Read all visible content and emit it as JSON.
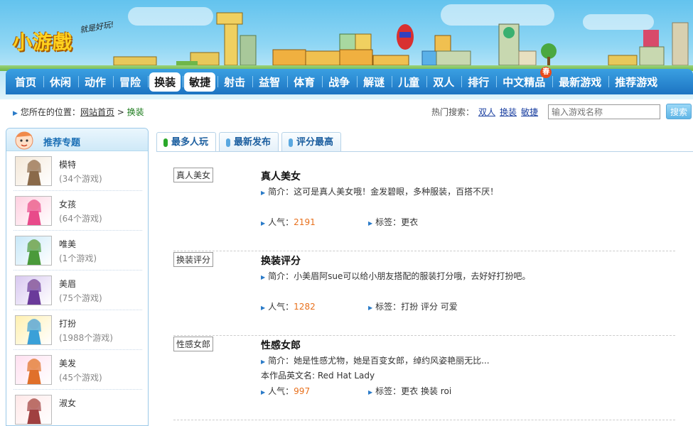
{
  "brand": {
    "logo": "小游戲",
    "slogan": "就是好玩!"
  },
  "nav": {
    "items": [
      {
        "label": "首页",
        "active": false
      },
      {
        "label": "休闲",
        "active": false
      },
      {
        "label": "动作",
        "active": false
      },
      {
        "label": "冒险",
        "active": false
      },
      {
        "label": "换装",
        "active": true
      },
      {
        "label": "敏捷",
        "active": true
      },
      {
        "label": "射击",
        "active": false
      },
      {
        "label": "益智",
        "active": false
      },
      {
        "label": "体育",
        "active": false
      },
      {
        "label": "战争",
        "active": false
      },
      {
        "label": "解谜",
        "active": false
      },
      {
        "label": "儿童",
        "active": false
      },
      {
        "label": "双人",
        "active": false
      },
      {
        "label": "排行",
        "active": false
      },
      {
        "label": "中文精品",
        "active": false,
        "badge": "春"
      },
      {
        "label": "最新游戏",
        "active": false
      },
      {
        "label": "推荐游戏",
        "active": false
      }
    ]
  },
  "location": {
    "prefix": "您所在的位置：",
    "home": "网站首页",
    "sep": " > ",
    "current": "换装"
  },
  "hot_search": {
    "label": "热门搜索：",
    "links": [
      "双人",
      "换装",
      "敏捷"
    ]
  },
  "search": {
    "placeholder": "输入游戏名称",
    "button": "搜索"
  },
  "sidebar": {
    "title": "推荐专题",
    "categories": [
      {
        "name": "模特",
        "count": "(34个游戏)"
      },
      {
        "name": "女孩",
        "count": "(64个游戏)"
      },
      {
        "name": "唯美",
        "count": "(1个游戏)"
      },
      {
        "name": "美眉",
        "count": "(75个游戏)"
      },
      {
        "name": "打扮",
        "count": "(1988个游戏)"
      },
      {
        "name": "美发",
        "count": "(45个游戏)"
      },
      {
        "name": "淑女",
        "count": ""
      }
    ]
  },
  "tabs": [
    {
      "label": "最多人玩",
      "active": true
    },
    {
      "label": "最新发布",
      "active": false
    },
    {
      "label": "评分最高",
      "active": false
    }
  ],
  "games": [
    {
      "tag": "真人美女",
      "title": "真人美女",
      "desc": "简介：这可是真人美女哦！金发碧眼，多种服装，百搭不厌！",
      "extra": "",
      "pop_label": "人气：",
      "pop": "2191",
      "tags_label": "标签：",
      "tags": "更衣"
    },
    {
      "tag": "换装评分",
      "title": "换装评分",
      "desc": "简介：小美眉阿sue可以给小朋友搭配的服装打分哦，去好好打扮吧。",
      "extra": "",
      "pop_label": "人气：",
      "pop": "1282",
      "tags_label": "标签：",
      "tags": "打扮 评分 可爱"
    },
    {
      "tag": "性感女郎",
      "title": "性感女郎",
      "desc": "简介：她是性感尤物，她是百变女郎，绰约风姿艳丽无比...",
      "extra": "本作品英文名: Red Hat Lady",
      "pop_label": "人气：",
      "pop": "997",
      "tags_label": "标签：",
      "tags": "更衣 换装 roi"
    }
  ],
  "colors": {
    "nav_blue": "#1d74c2",
    "accent_orange": "#e8701c",
    "link_blue": "#1a3fa0"
  }
}
